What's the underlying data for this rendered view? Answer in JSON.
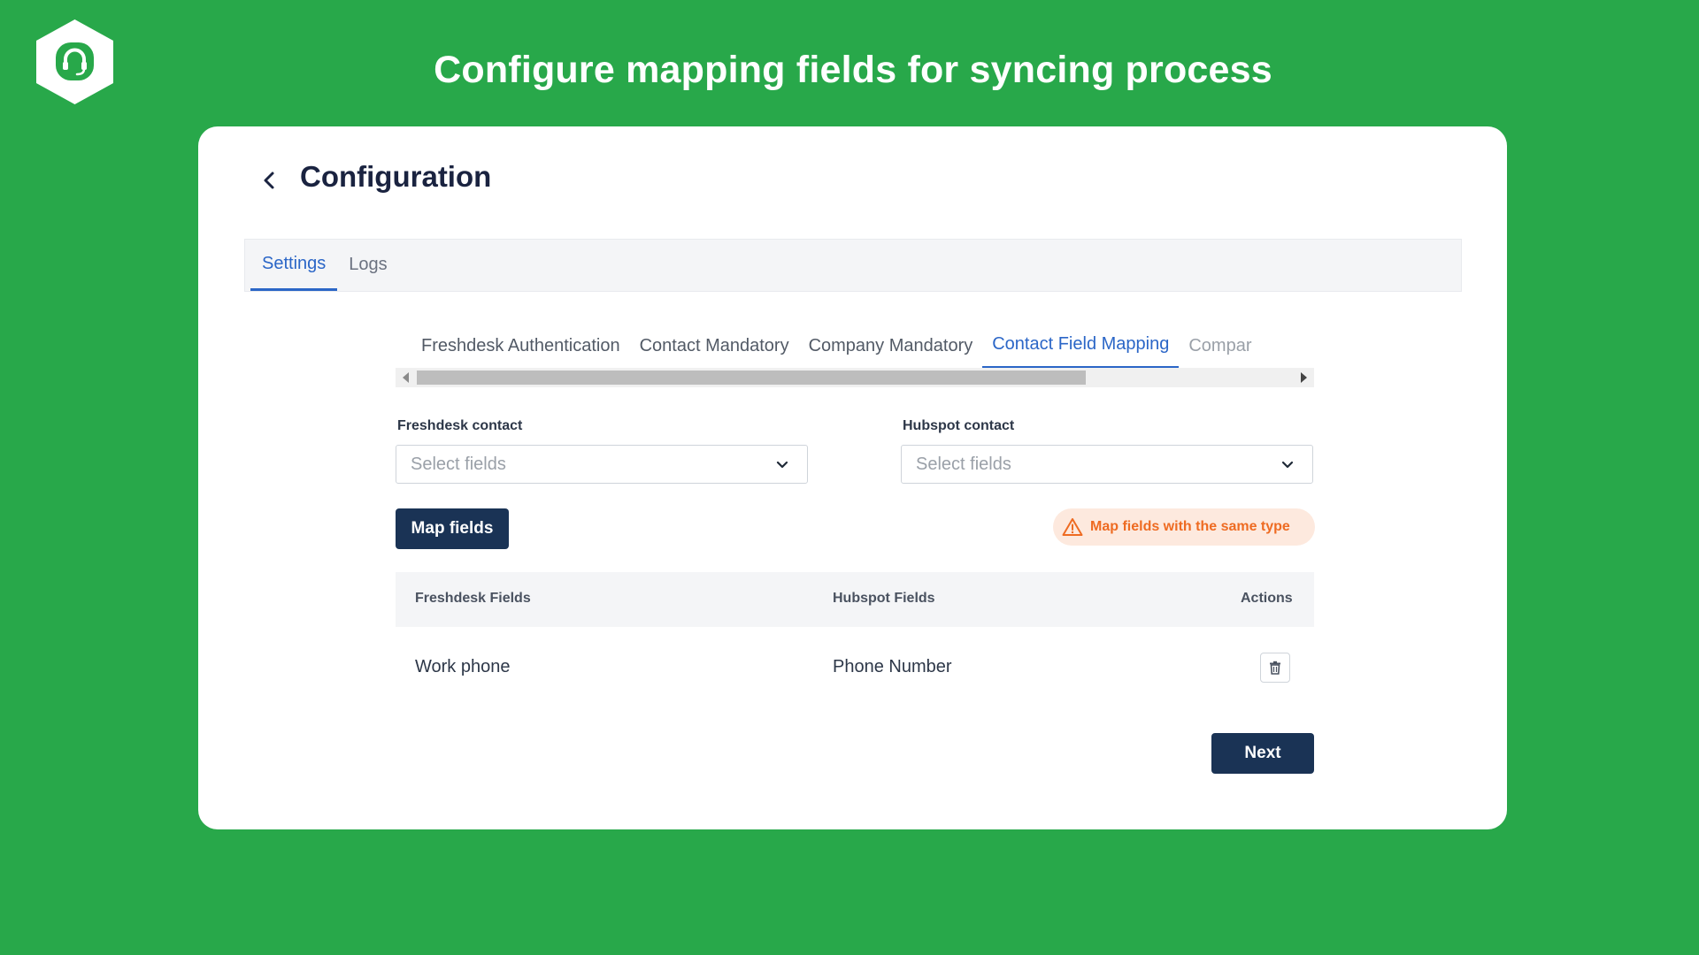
{
  "banner": {
    "title": "Configure mapping fields for syncing process"
  },
  "logo": {
    "icon": "headset-icon"
  },
  "page": {
    "title": "Configuration"
  },
  "top_tabs": [
    {
      "label": "Settings",
      "active": true
    },
    {
      "label": "Logs",
      "active": false
    }
  ],
  "sub_tabs": [
    {
      "label": "Freshdesk Authentication",
      "active": false
    },
    {
      "label": "Contact Mandatory",
      "active": false
    },
    {
      "label": "Company Mandatory",
      "active": false
    },
    {
      "label": "Contact Field Mapping",
      "active": true
    },
    {
      "label": "Compar",
      "active": false
    }
  ],
  "form": {
    "freshdesk_label": "Freshdesk contact",
    "freshdesk_placeholder": "Select fields",
    "hubspot_label": "Hubspot contact",
    "hubspot_placeholder": "Select fields",
    "map_button": "Map fields",
    "warning": "Map fields with the same type"
  },
  "table": {
    "headers": [
      "Freshdesk Fields",
      "Hubspot Fields",
      "Actions"
    ],
    "rows": [
      {
        "freshdesk": "Work phone",
        "hubspot": "Phone Number"
      }
    ]
  },
  "footer": {
    "next_button": "Next"
  },
  "colors": {
    "background": "#28a84a",
    "primary_button": "#1a3355",
    "active_tab": "#2b66c7",
    "warning_text": "#ee6b22",
    "warning_bg": "#fde9de"
  }
}
